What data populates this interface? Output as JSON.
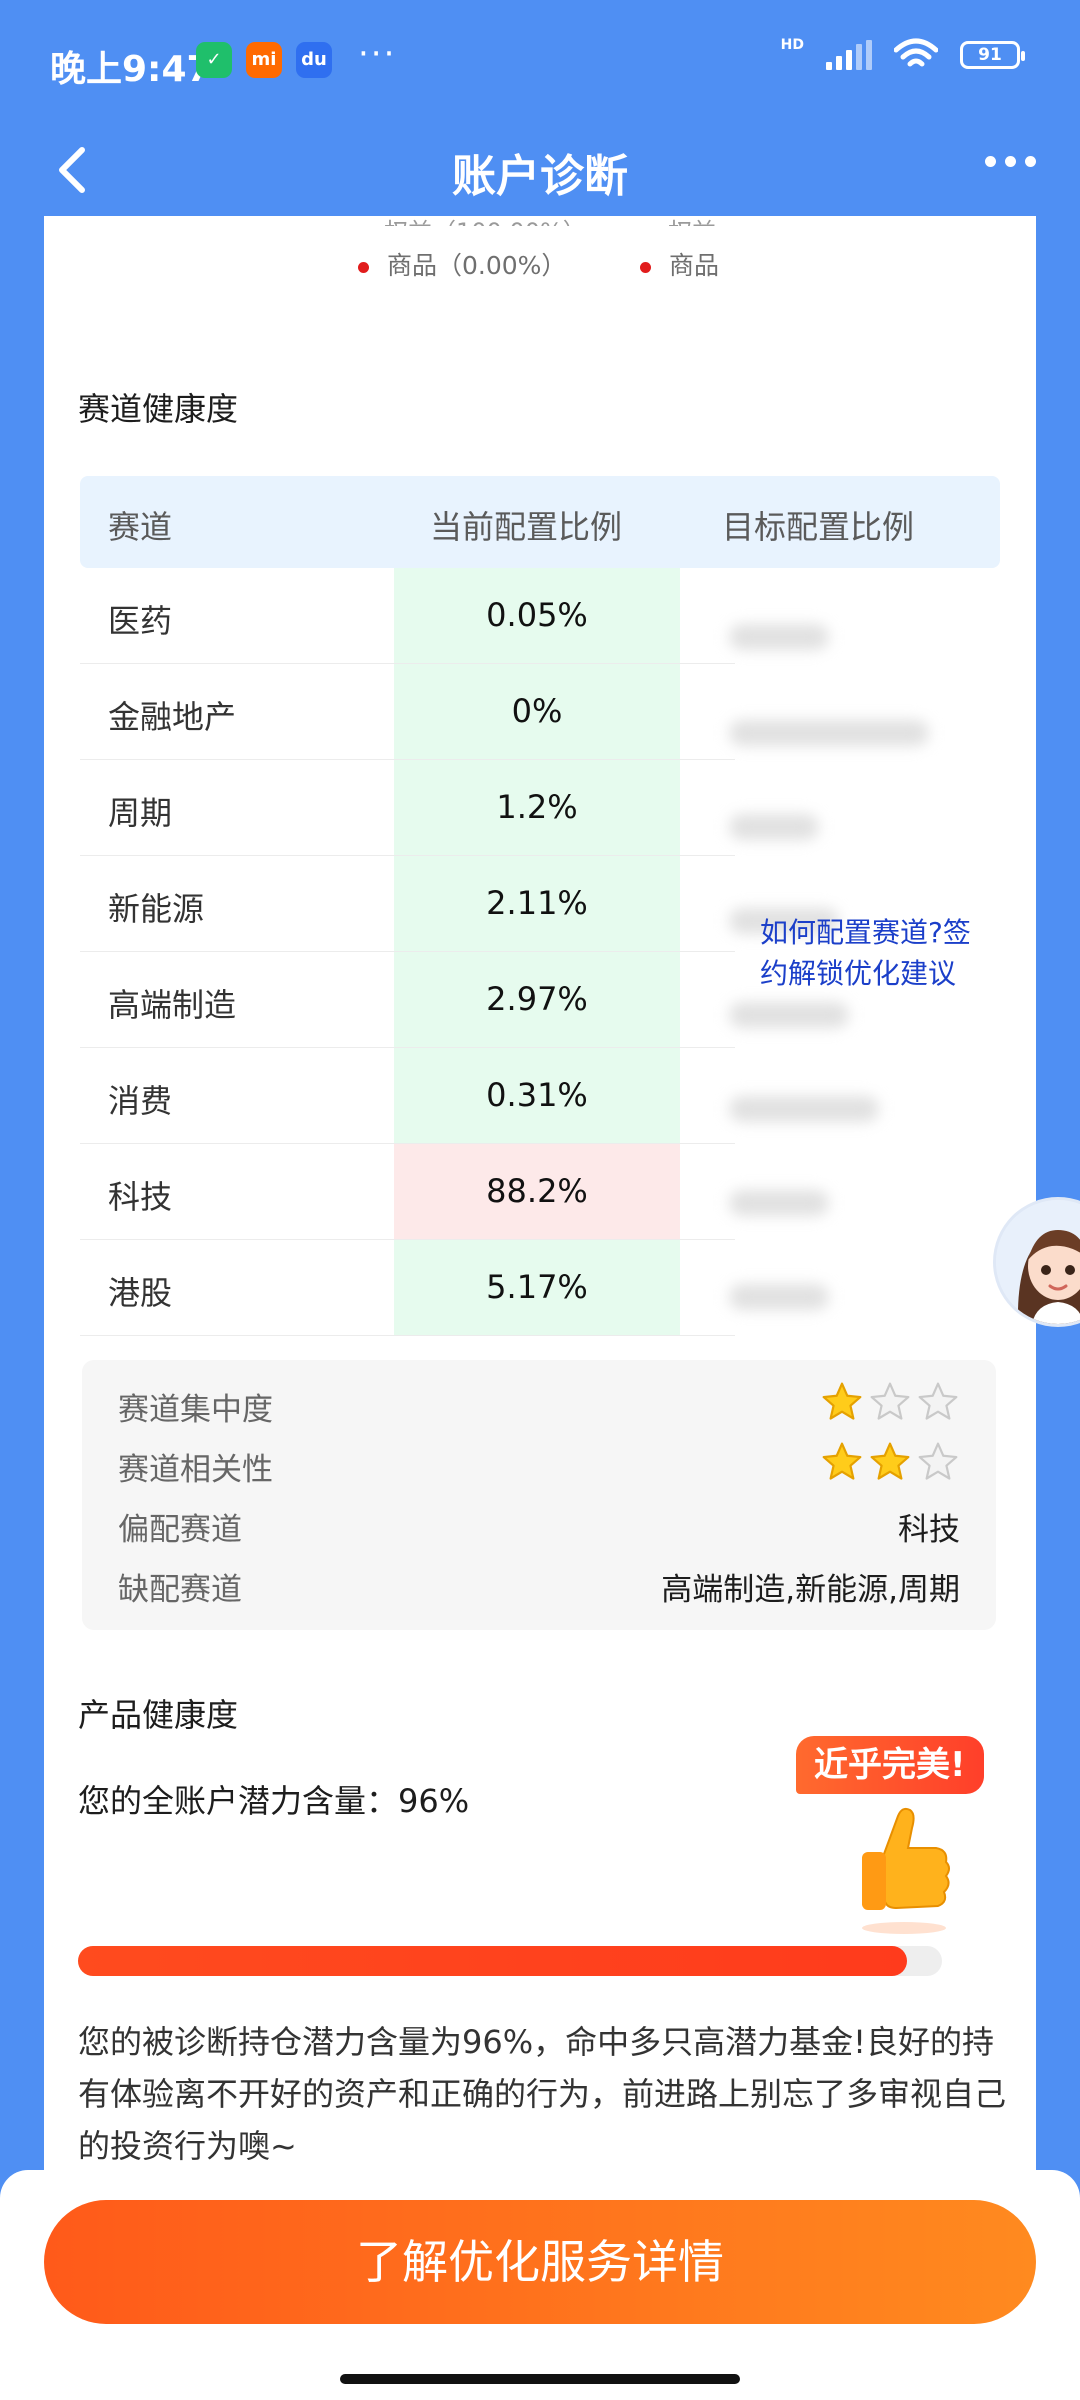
{
  "status_bar": {
    "time": "晚上9:47",
    "apps": [
      "shield-app-icon",
      "mi-app-icon",
      "baidu-app-icon"
    ],
    "more": "···",
    "network": "HD",
    "battery": "91"
  },
  "nav": {
    "title": "账户诊断"
  },
  "legend": {
    "left": "商品（0.00%）",
    "right": "商品"
  },
  "track_health": {
    "title": "赛道健康度",
    "headers": [
      "赛道",
      "当前配置比例",
      "目标配置比例"
    ],
    "rows": [
      {
        "name": "医药",
        "current": "0.05%"
      },
      {
        "name": "金融地产",
        "current": "0%"
      },
      {
        "name": "周期",
        "current": "1.2%"
      },
      {
        "name": "新能源",
        "current": "2.11%"
      },
      {
        "name": "高端制造",
        "current": "2.97%"
      },
      {
        "name": "消费",
        "current": "0.31%"
      },
      {
        "name": "科技",
        "current": "88.2%"
      },
      {
        "name": "港股",
        "current": "5.17%"
      }
    ],
    "unlock_link": "如何配置赛道?签约解锁优化建议"
  },
  "summary": {
    "concentration": {
      "label": "赛道集中度",
      "stars": 1,
      "max": 3
    },
    "correlation": {
      "label": "赛道相关性",
      "stars": 2,
      "max": 3
    },
    "overweight": {
      "label": "偏配赛道",
      "value": "科技"
    },
    "underweight": {
      "label": "缺配赛道",
      "value": "高端制造,新能源,周期"
    }
  },
  "product_health": {
    "title": "产品健康度",
    "potential_text": "您的全账户潜力含量：96%",
    "potential_fraction": 0.96,
    "badge": "近乎完美!",
    "description": "您的被诊断持仓潜力含量为96%，命中多只高潜力基金!良好的持有体验离不开好的资产和正确的行为，前进路上别忘了多审视自己的投资行为噢~"
  },
  "cta": {
    "label": "了解优化服务详情"
  },
  "colors": {
    "primary_blue": "#4f8ff3",
    "cta_orange": "#ff6a1c",
    "green_cell": "#e6fbee",
    "red_cell": "#fde9e9",
    "link": "#1b3fc9"
  }
}
